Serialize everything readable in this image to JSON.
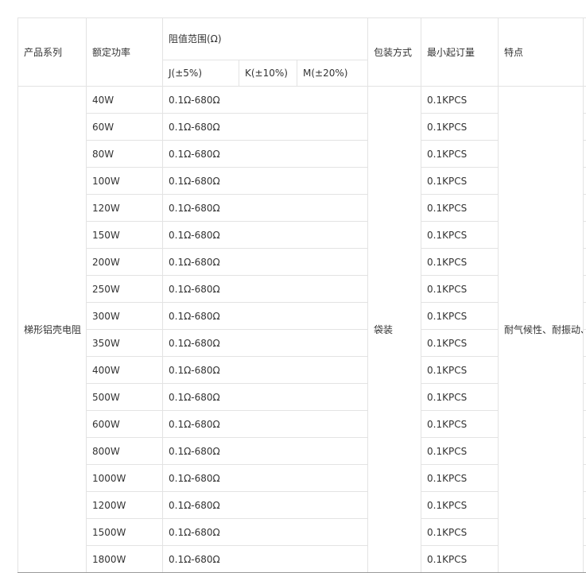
{
  "header": {
    "series": "产品系列",
    "power": "额定功率",
    "resistance_range": "阻值范围(Ω)",
    "j": "J(±5%)",
    "k": "K(±10%)",
    "m": "M(±20%)",
    "packaging": "包装方式",
    "moq": "最小起订量",
    "features": "特点"
  },
  "product": {
    "series": "梯形铝壳电阻",
    "packaging": "袋装",
    "features": "耐气候性、耐振动、安全性、优于传统瓷骨架电阻器。广泛应用于电源、变频器、伺服系统等高要求的电器回路中，并且适用于恶劣的工控环境。易紧密安装，易附加散热器。外型美观，是电力、电子理想的配套产品。"
  },
  "rows": [
    {
      "power": "40W",
      "j": "0.1Ω-680Ω",
      "moq": "0.1KPCS"
    },
    {
      "power": "60W",
      "j": "0.1Ω-680Ω",
      "moq": "0.1KPCS"
    },
    {
      "power": "80W",
      "j": "0.1Ω-680Ω",
      "moq": "0.1KPCS"
    },
    {
      "power": "100W",
      "j": "0.1Ω-680Ω",
      "moq": "0.1KPCS"
    },
    {
      "power": "120W",
      "j": "0.1Ω-680Ω",
      "moq": "0.1KPCS"
    },
    {
      "power": "150W",
      "j": "0.1Ω-680Ω",
      "moq": "0.1KPCS"
    },
    {
      "power": "200W",
      "j": "0.1Ω-680Ω",
      "moq": "0.1KPCS"
    },
    {
      "power": "250W",
      "j": "0.1Ω-680Ω",
      "moq": "0.1KPCS"
    },
    {
      "power": "300W",
      "j": "0.1Ω-680Ω",
      "moq": "0.1KPCS"
    },
    {
      "power": "350W",
      "j": "0.1Ω-680Ω",
      "moq": "0.1KPCS"
    },
    {
      "power": "400W",
      "j": "0.1Ω-680Ω",
      "moq": "0.1KPCS"
    },
    {
      "power": "500W",
      "j": "0.1Ω-680Ω",
      "moq": "0.1KPCS"
    },
    {
      "power": "600W",
      "j": "0.1Ω-680Ω",
      "moq": "0.1KPCS"
    },
    {
      "power": "800W",
      "j": "0.1Ω-680Ω",
      "moq": "0.1KPCS"
    },
    {
      "power": "1000W",
      "j": "0.1Ω-680Ω",
      "moq": "0.1KPCS"
    },
    {
      "power": "1200W",
      "j": "0.1Ω-680Ω",
      "moq": "0.1KPCS"
    },
    {
      "power": "1500W",
      "j": "0.1Ω-680Ω",
      "moq": "0.1KPCS"
    },
    {
      "power": "1800W",
      "j": "0.1Ω-680Ω",
      "moq": "0.1KPCS"
    }
  ]
}
